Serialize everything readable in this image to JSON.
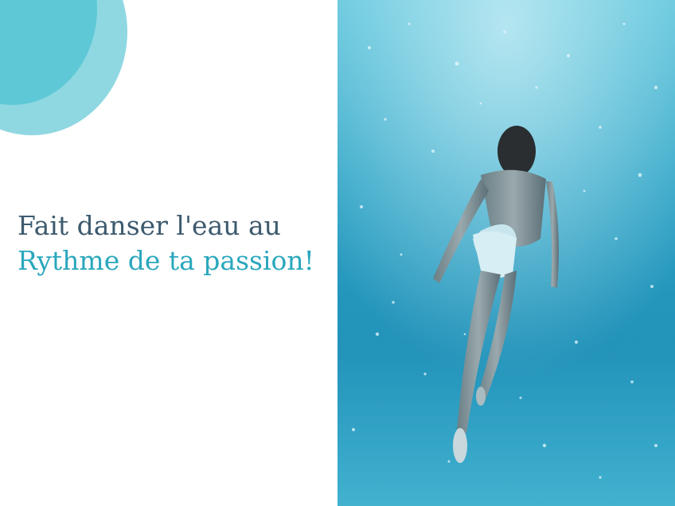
{
  "slide": {
    "headline_line1": "Fait danser l'eau au",
    "headline_line2": "Rythme de ta passion!"
  },
  "colors": {
    "headline_dark": "#3d5a6e",
    "headline_accent": "#2aa7bd",
    "circle_light": "#8fd8e2",
    "circle_dark": "#5fc8d6"
  },
  "photo": {
    "subject": "underwater-swimmer-photo"
  }
}
